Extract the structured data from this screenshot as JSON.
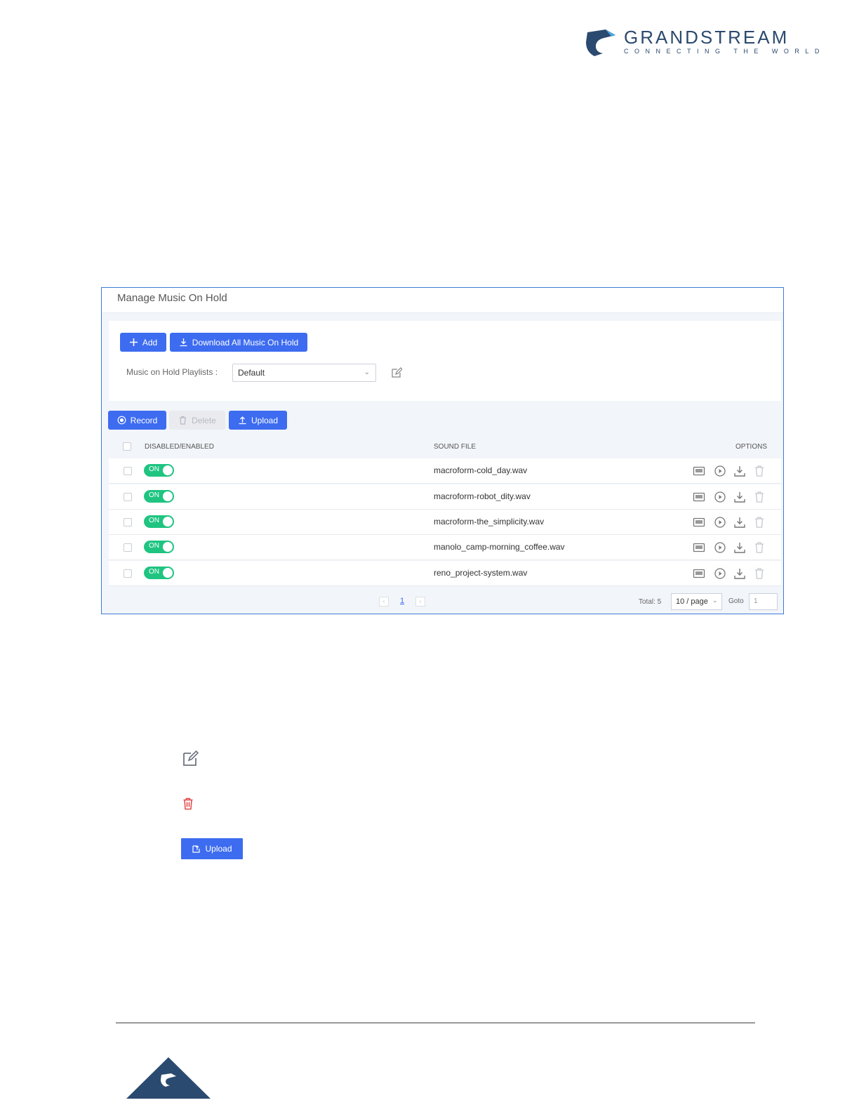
{
  "header": {
    "brand": "GRANDSTREAM",
    "tagline": "CONNECTING THE WORLD"
  },
  "panel": {
    "title": "Manage Music On Hold",
    "add_label": "Add",
    "download_all_label": "Download All Music On Hold",
    "playlist_label": "Music on Hold Playlists :",
    "playlist_value": "Default",
    "record_label": "Record",
    "delete_label": "Delete",
    "upload_label": "Upload",
    "columns": {
      "enabled": "DISABLED/ENABLED",
      "sound_file": "SOUND FILE",
      "options": "OPTIONS"
    },
    "rows": [
      {
        "toggle": "ON",
        "file": "macroform-cold_day.wav"
      },
      {
        "toggle": "ON",
        "file": "macroform-robot_dity.wav"
      },
      {
        "toggle": "ON",
        "file": "macroform-the_simplicity.wav"
      },
      {
        "toggle": "ON",
        "file": "manolo_camp-morning_coffee.wav"
      },
      {
        "toggle": "ON",
        "file": "reno_project-system.wav"
      }
    ],
    "pagination": {
      "current_page": "1",
      "total": "Total: 5",
      "page_size": "10 / page",
      "goto_label": "Goto",
      "goto_value": "1"
    }
  },
  "legend": {
    "upload_label": "Upload"
  },
  "colors": {
    "primary": "#3d6cf0",
    "toggle_on": "#1fc481",
    "delete_icon": "#e04848",
    "brand": "#2b4a6f"
  }
}
